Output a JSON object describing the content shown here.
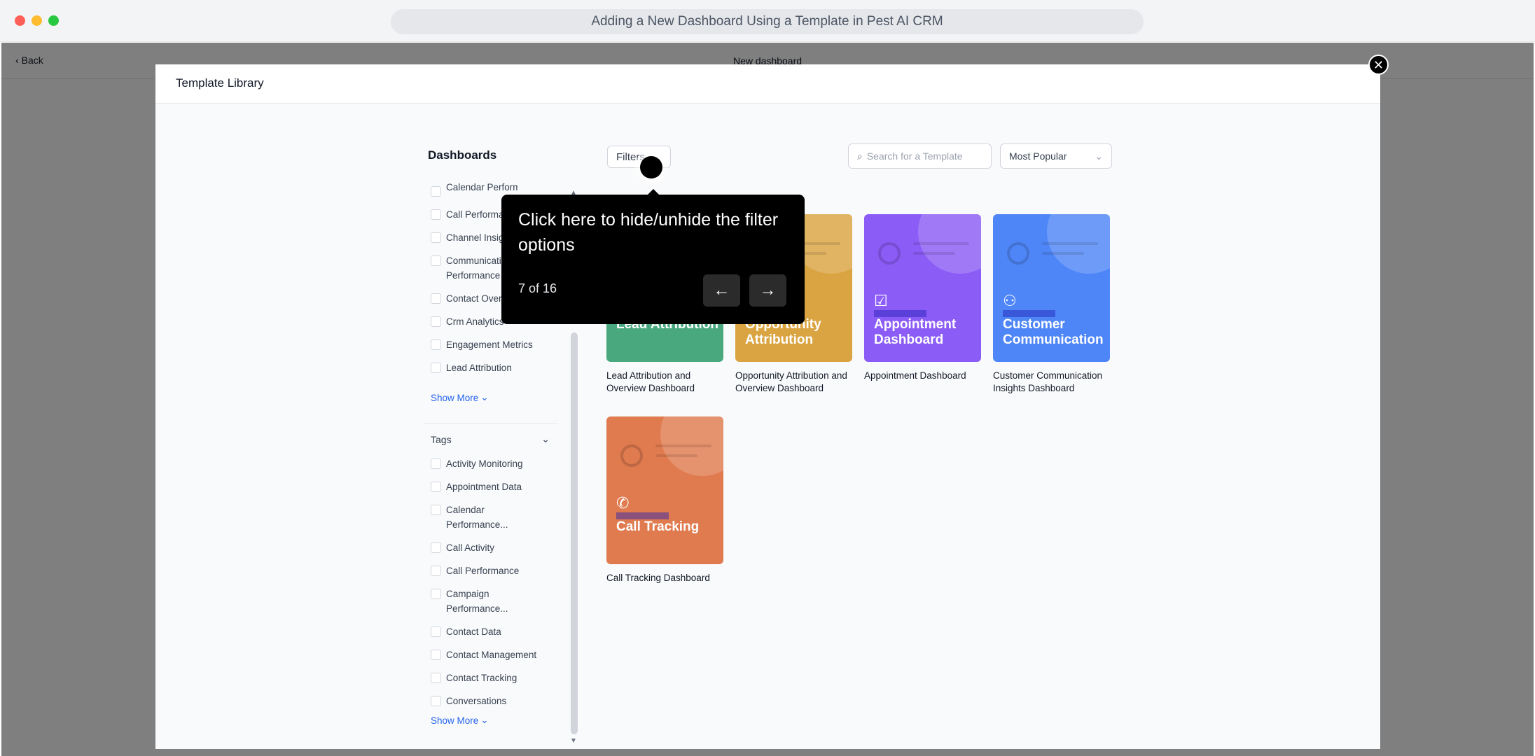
{
  "window": {
    "title": "Adding a New Dashboard Using a Template in Pest AI CRM"
  },
  "app": {
    "back_label": "Back",
    "page_title": "New dashboard"
  },
  "modal": {
    "title": "Template Library",
    "close_glyph": "✕"
  },
  "sidebar": {
    "title": "Dashboards",
    "filters_label": "Filters",
    "categories": [
      "Calendar Performance",
      "Call Performance",
      "Channel Insights",
      "Communication Performance",
      "Contact Overview",
      "Crm Analytics",
      "Engagement Metrics",
      "Lead Attribution"
    ],
    "show_more_label": "Show More",
    "tags_title": "Tags",
    "tags": [
      "Activity Monitoring",
      "Appointment Data",
      "Calendar Performance...",
      "Call Activity",
      "Call Performance",
      "Campaign Performance...",
      "Contact Data",
      "Contact Management",
      "Contact Tracking",
      "Conversations"
    ]
  },
  "search": {
    "placeholder": "Search for a Template"
  },
  "sort": {
    "selected": "Most Popular"
  },
  "templates": [
    {
      "heading": "Lead Attribution",
      "caption": "Lead Attribution and Overview Dashboard",
      "color": "#4aa87e",
      "icon": "chart-icon"
    },
    {
      "heading": "Opportunity Attribution",
      "caption": "Opportunity Attribution and Overview Dashboard",
      "color": "#d9a441",
      "icon": "chart-icon"
    },
    {
      "heading": "Appointment Dashboard",
      "caption": "Appointment Dashboard",
      "color": "#8b5cf6",
      "icon": "calendar-check-icon"
    },
    {
      "heading": "Customer Communication",
      "caption": "Customer Communication Insights Dashboard",
      "color": "#4f86f7",
      "icon": "users-icon"
    },
    {
      "heading": "Call Tracking",
      "caption": "Call Tracking Dashboard",
      "color": "#e07b4f",
      "icon": "phone-call-icon"
    }
  ],
  "tooltip": {
    "text": "Click here to hide/unhide the filter options",
    "step": "7 of 16",
    "prev_glyph": "←",
    "next_glyph": "→"
  }
}
